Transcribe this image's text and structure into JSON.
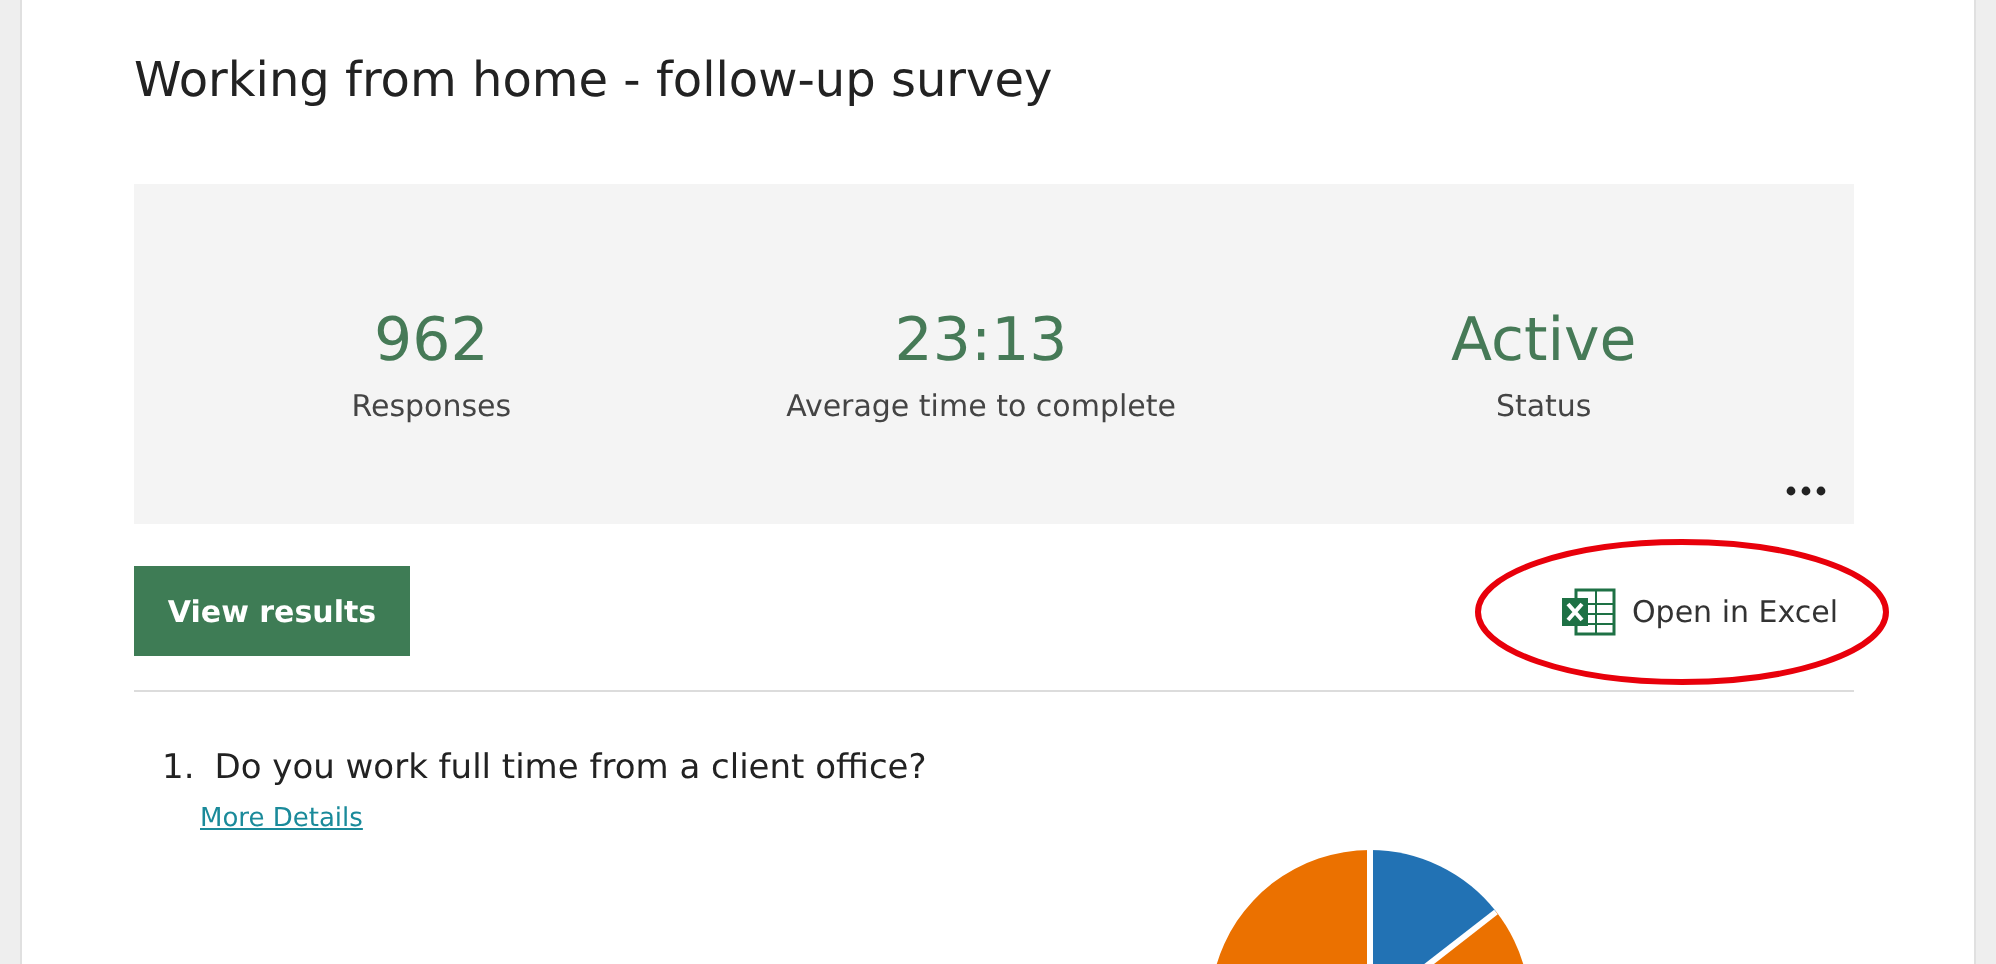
{
  "title": "Working from home - follow-up survey",
  "stats": [
    {
      "value": "962",
      "label": "Responses"
    },
    {
      "value": "23:13",
      "label": "Average time to complete"
    },
    {
      "value": "Active",
      "label": "Status"
    }
  ],
  "actions": {
    "view_results": "View results",
    "open_in_excel": "Open in Excel"
  },
  "questions": [
    {
      "number": "1.",
      "text": "Do you work full time from a client office?",
      "link": "More Details",
      "chart": {
        "kind": "pie"
      }
    }
  ]
}
